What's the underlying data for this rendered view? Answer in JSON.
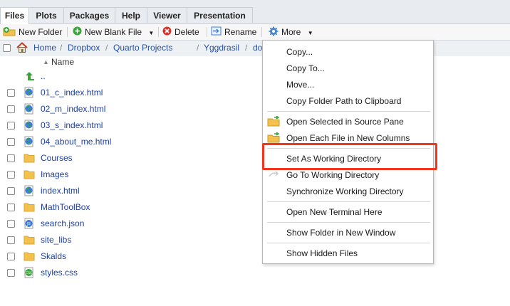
{
  "tabs": [
    "Files",
    "Plots",
    "Packages",
    "Help",
    "Viewer",
    "Presentation"
  ],
  "toolbar": {
    "new_folder": "New Folder",
    "new_blank_file": "New Blank File",
    "delete": "Delete",
    "rename": "Rename",
    "more": "More"
  },
  "breadcrumb": [
    "Home",
    "Dropbox",
    "Quarto Projects",
    "Yggdrasil",
    "docs"
  ],
  "column_header": "Name",
  "files": [
    {
      "name": "..",
      "type": "parent-dir-icon"
    },
    {
      "name": "01_c_index.html",
      "type": "html-file-icon"
    },
    {
      "name": "02_m_index.html",
      "type": "html-file-icon"
    },
    {
      "name": "03_s_index.html",
      "type": "html-file-icon"
    },
    {
      "name": "04_about_me.html",
      "type": "html-file-icon"
    },
    {
      "name": "Courses",
      "type": "folder-icon"
    },
    {
      "name": "Images",
      "type": "folder-icon"
    },
    {
      "name": "index.html",
      "type": "html-file-icon"
    },
    {
      "name": "MathToolBox",
      "type": "folder-icon"
    },
    {
      "name": "search.json",
      "type": "json-file-icon"
    },
    {
      "name": "site_libs",
      "type": "folder-icon"
    },
    {
      "name": "Skalds",
      "type": "folder-icon"
    },
    {
      "name": "styles.css",
      "type": "css-file-icon"
    }
  ],
  "more_menu": {
    "items": [
      "Copy...",
      "Copy To...",
      "Move...",
      "Copy Folder Path to Clipboard",
      "Open Selected in Source Pane",
      "Open Each File in New Columns",
      "Set As Working Directory",
      "Go To Working Directory",
      "Synchronize Working Directory",
      "Open New Terminal Here",
      "Show Folder in New Window",
      "Show Hidden Files"
    ],
    "highlighted_item": "Set As Working Directory",
    "highlight_color": "#f0361e"
  },
  "colors": {
    "link": "#1e3fa0",
    "breadcrumb": "#2850a8",
    "folder": "#f2c14e",
    "accent_green": "#3aa63a",
    "delete_red": "#d9342b"
  }
}
